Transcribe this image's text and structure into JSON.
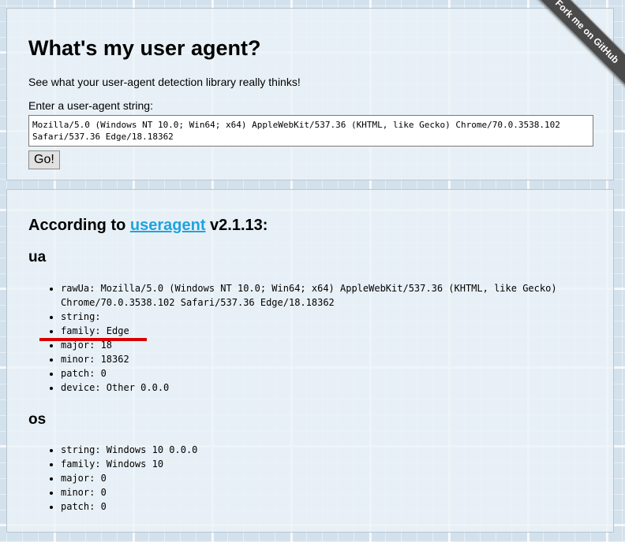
{
  "header": {
    "title": "What's my user agent?",
    "tagline": "See what your user-agent detection library really thinks!",
    "input_label": "Enter a user-agent string:",
    "input_value": "Mozilla/5.0 (Windows NT 10.0; Win64; x64) AppleWebKit/537.36 (KHTML, like Gecko) Chrome/70.0.3538.102 Safari/537.36 Edge/18.18362",
    "go_label": "Go!"
  },
  "ribbon": {
    "label": "Fork me on GitHub"
  },
  "result": {
    "prefix": "According to ",
    "library": "useragent",
    "version": " v2.1.13:",
    "ua": {
      "heading": "ua",
      "items": [
        "rawUa: Mozilla/5.0 (Windows NT 10.0; Win64; x64) AppleWebKit/537.36 (KHTML, like Gecko) Chrome/70.0.3538.102 Safari/537.36 Edge/18.18362",
        "string:",
        "family: Edge",
        "major: 18",
        "minor: 18362",
        "patch: 0",
        "device: Other 0.0.0"
      ]
    },
    "os": {
      "heading": "os",
      "items": [
        "string: Windows 10 0.0.0",
        "family: Windows 10",
        "major: 0",
        "minor: 0",
        "patch: 0"
      ]
    }
  },
  "colors": {
    "link": "#1fa3e0",
    "highlight_mark": "#d60000",
    "ribbon": "#4a4a4a"
  }
}
